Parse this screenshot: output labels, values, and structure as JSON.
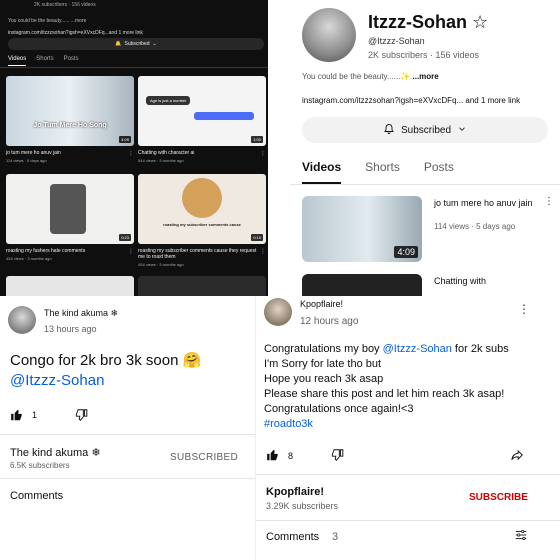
{
  "dark_panel": {
    "subscribers_line": "2K subscribers · 156 videos",
    "description": "You could be the beauty...... ...more",
    "link": "instagram.com/itzzzsohan?igsh=eXVxcDFq...and 1 more link",
    "subscribe_label": "Subscribed",
    "tabs": [
      "Videos",
      "Shorts",
      "Posts"
    ],
    "videos": [
      {
        "title": "jo tum mere ho anuv jain",
        "meta": "114 views · 5 days ago",
        "duration": "4:09",
        "overlay": "Jo Tum Mere Ho Song"
      },
      {
        "title": "Chatting with character ai",
        "meta": "544 views · 3 months ago",
        "duration": "1:00",
        "overlay": "Age is just a number"
      },
      {
        "title": "roasting my fushers hate comments",
        "meta": "454 views · 3 months ago",
        "duration": "0:23",
        "overlay": ""
      },
      {
        "title": "roasting my subscriber comments cause they request me to roast them",
        "meta": "454 views · 3 months ago",
        "duration": "0:19",
        "overlay": "roasting my subscriber comments cause"
      }
    ]
  },
  "channel": {
    "name": "Itzzz-Sohan ☆",
    "handle": "@Itzzz-Sohan",
    "stats": "2K subscribers · 156 videos",
    "description": "You could be the beauty......✨",
    "more": "...more",
    "link": "instagram.com/itzzzsohan?igsh=eXVxcDFq... and 1 more link",
    "subscribe_label": "Subscribed",
    "tabs": [
      "Videos",
      "Shorts",
      "Posts"
    ],
    "video1": {
      "title": "jo tum mere ho anuv jain",
      "meta": "114 views · 5 days ago",
      "duration": "4:09"
    },
    "video2": {
      "title": "Chatting with"
    }
  },
  "comment_left": {
    "author": "The kind akuma ❄",
    "time": "13 hours ago",
    "text": "Congo for 2k  bro 3k soon 🤗",
    "mention": "@Itzzz-Sohan",
    "likes": "1",
    "channel_name": "The kind akuma ❄",
    "channel_subs": "6.5K subscribers",
    "subscribe_label": "SUBSCRIBED",
    "comments_label": "Comments"
  },
  "comment_right": {
    "author": "Kpopflaire!",
    "time": "12 hours ago",
    "line1_pre": "Congratulations my boy ",
    "line1_mention": "@Itzzz-Sohan",
    "line1_post": " for 2k subs",
    "line2": "I'm Sorry for late tho but",
    "line3": "Hope you reach 3k asap",
    "line4": "Please share this post and let him reach 3k asap!",
    "line5": "Congratulations once again!<3",
    "hashtag": "#roadto3k",
    "likes": "8",
    "channel_name": "Kpopflaire!",
    "channel_subs": "3.29K subscribers",
    "subscribe_label": "SUBSCRIBE",
    "comments_label": "Comments",
    "comments_count": "3"
  },
  "colors": {
    "link": "#065fd4",
    "subscribe_red": "#cc0000",
    "dark_bg": "#0f0f0f"
  }
}
